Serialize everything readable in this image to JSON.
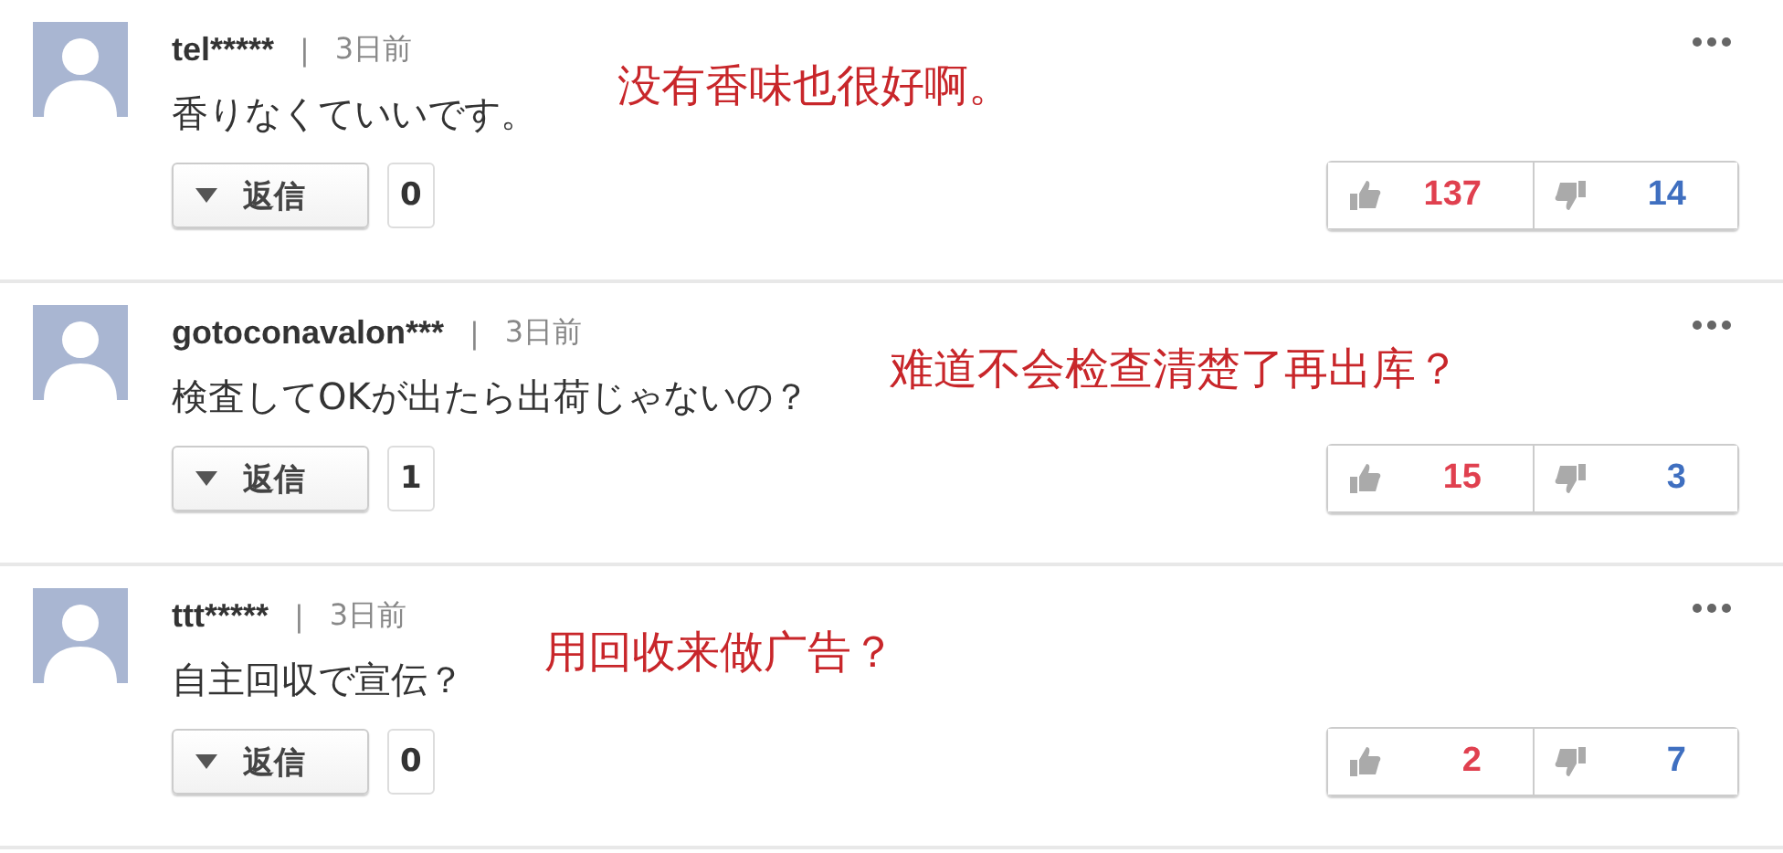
{
  "comments": [
    {
      "user": "tel*****",
      "separator": "|",
      "time": "3日前",
      "body": "香りなくていいです。",
      "translation": "没有香味也很好啊。",
      "reply_label": "返信",
      "reply_count": "0",
      "likes": "137",
      "dislikes": "14"
    },
    {
      "user": "gotoconavalon***",
      "separator": "|",
      "time": "3日前",
      "body": "検査してOKが出たら出荷じゃないの？",
      "translation": "难道不会检查清楚了再出库？",
      "reply_label": "返信",
      "reply_count": "1",
      "likes": "15",
      "dislikes": "3"
    },
    {
      "user": "ttt*****",
      "separator": "|",
      "time": "3日前",
      "body": "自主回収で宣伝？",
      "translation": "用回收来做广告？",
      "reply_label": "返信",
      "reply_count": "0",
      "likes": "2",
      "dislikes": "7"
    }
  ]
}
